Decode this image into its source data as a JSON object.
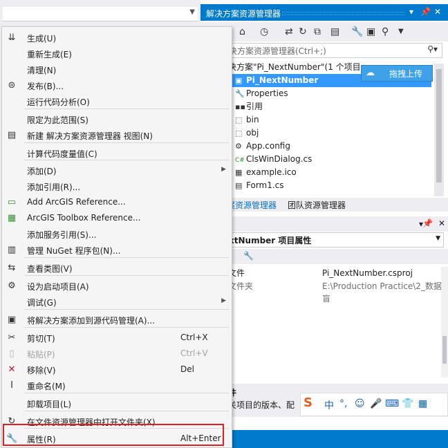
{
  "solution_explorer": {
    "title": "解决方案资源管理器",
    "search_placeholder": "决方案资源管理器(Ctrl+;)",
    "solution_label": "决方案\"Pi_NextNumber\"(1 个项目",
    "upload_button": "拖拽上传",
    "tree": [
      {
        "label": "Pi_NextNumber",
        "icon": "csharp-project-icon"
      },
      {
        "label": "Properties",
        "icon": "wrench-icon"
      },
      {
        "label": "引用",
        "icon": "references-icon"
      },
      {
        "label": "bin",
        "icon": "folder-icon"
      },
      {
        "label": "obj",
        "icon": "folder-icon"
      },
      {
        "label": "App.config",
        "icon": "config-file-icon"
      },
      {
        "label": "ClsWinDialog.cs",
        "icon": "csharp-file-icon"
      },
      {
        "label": "example.ico",
        "icon": "ico-file-icon"
      },
      {
        "label": "Form1.cs",
        "icon": "form-icon"
      }
    ],
    "tabs": [
      "案资源管理器",
      "团队资源管理器"
    ]
  },
  "properties": {
    "selector": "xtNumber 项目属性",
    "rows": [
      {
        "name": "文件",
        "value": "Pi_NextNumber.csproj"
      },
      {
        "name": "文件夹",
        "value": "E:\\Production Practice\\2_数据盲"
      }
    ],
    "desc_title": "件",
    "desc_text": "关项目的版本、配"
  },
  "ime_toolbar": {
    "items": [
      "中",
      "°,",
      "☺",
      "🎤",
      "⌨",
      "👕",
      "▦"
    ]
  },
  "context_menu": {
    "items": [
      {
        "label": "生成(U)",
        "icon": "build-icon"
      },
      {
        "label": "重新生成(E)",
        "icon": ""
      },
      {
        "label": "清理(N)",
        "icon": ""
      },
      {
        "label": "发布(B)...",
        "icon": "publish-icon"
      },
      {
        "label": "运行代码分析(O)",
        "icon": ""
      },
      {
        "label": "限定为此范围(S)",
        "icon": ""
      },
      {
        "label": "新建 解决方案资源管理器 视图(N)",
        "icon": "new-view-icon"
      },
      {
        "label": "计算代码度量值(C)",
        "icon": ""
      },
      {
        "label": "添加(D)",
        "icon": "",
        "submenu": true
      },
      {
        "label": "添加引用(R)...",
        "icon": ""
      },
      {
        "label": "Add ArcGIS Reference...",
        "icon": "arcgis-reference-icon"
      },
      {
        "label": "ArcGIS Toolbox Reference...",
        "icon": "arcgis-toolbox-icon"
      },
      {
        "label": "添加服务引用(S)...",
        "icon": ""
      },
      {
        "label": "管理 NuGet 程序包(N)...",
        "icon": "nuget-icon"
      },
      {
        "label": "查看类图(V)",
        "icon": "class-diagram-icon"
      },
      {
        "label": "设为启动项目(A)",
        "icon": "gear-icon"
      },
      {
        "label": "调试(G)",
        "icon": "",
        "submenu": true
      },
      {
        "label": "将解决方案添加到源代码管理(A)...",
        "icon": "source-control-icon"
      },
      {
        "label": "剪切(T)",
        "icon": "scissors-icon",
        "shortcut": "Ctrl+X"
      },
      {
        "label": "粘贴(P)",
        "icon": "paste-icon",
        "shortcut": "Ctrl+V",
        "disabled": true
      },
      {
        "label": "移除(V)",
        "icon": "remove-x-icon",
        "shortcut": "Del"
      },
      {
        "label": "重命名(M)",
        "icon": "rename-icon"
      },
      {
        "label": "卸载项目(L)",
        "icon": ""
      },
      {
        "label": "在文件资源管理器中打开文件夹(X)",
        "icon": "open-folder-icon"
      },
      {
        "label": "属性(R)",
        "icon": "wrench-icon",
        "shortcut": "Alt+Enter"
      }
    ]
  },
  "colors": {
    "accent": "#007acc",
    "selection": "#3399ff",
    "highlight_box": "#e02020"
  }
}
